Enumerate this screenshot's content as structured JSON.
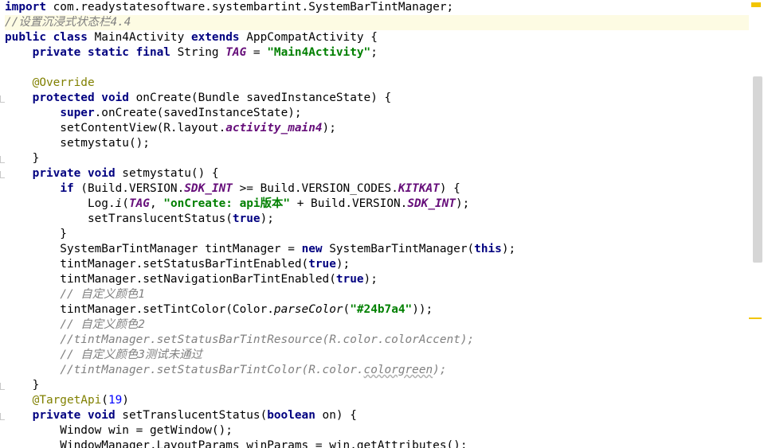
{
  "editor": {
    "lines": [
      [
        {
          "t": "import",
          "c": "kw"
        },
        {
          "t": " com.readystatesoftware.systembartint.SystemBarTintManager;",
          "c": ""
        }
      ],
      [
        {
          "t": "//设置沉浸式状态栏4.4",
          "c": "cmt"
        }
      ],
      [
        {
          "t": "public class",
          "c": "kw"
        },
        {
          "t": " Main4Activity ",
          "c": ""
        },
        {
          "t": "extends",
          "c": "kw"
        },
        {
          "t": " AppCompatActivity {",
          "c": ""
        }
      ],
      [
        {
          "t": "    ",
          "c": ""
        },
        {
          "t": "private static final",
          "c": "kw"
        },
        {
          "t": " String ",
          "c": ""
        },
        {
          "t": "TAG",
          "c": "fld"
        },
        {
          "t": " = ",
          "c": ""
        },
        {
          "t": "\"Main4Activity\"",
          "c": "str"
        },
        {
          "t": ";",
          "c": ""
        }
      ],
      [],
      [
        {
          "t": "    ",
          "c": ""
        },
        {
          "t": "@Override",
          "c": "ann"
        }
      ],
      [
        {
          "t": "    ",
          "c": ""
        },
        {
          "t": "protected void",
          "c": "kw"
        },
        {
          "t": " onCreate(Bundle savedInstanceState) {",
          "c": ""
        }
      ],
      [
        {
          "t": "        ",
          "c": ""
        },
        {
          "t": "super",
          "c": "kw"
        },
        {
          "t": ".onCreate(savedInstanceState);",
          "c": ""
        }
      ],
      [
        {
          "t": "        setContentView(R.layout.",
          "c": ""
        },
        {
          "t": "activity_main4",
          "c": "fld"
        },
        {
          "t": ");",
          "c": ""
        }
      ],
      [
        {
          "t": "        setmystatu();",
          "c": ""
        }
      ],
      [
        {
          "t": "    }",
          "c": ""
        }
      ],
      [
        {
          "t": "    ",
          "c": ""
        },
        {
          "t": "private void",
          "c": "kw"
        },
        {
          "t": " setmystatu() {",
          "c": ""
        }
      ],
      [
        {
          "t": "        ",
          "c": ""
        },
        {
          "t": "if",
          "c": "kw"
        },
        {
          "t": " (Build.VERSION.",
          "c": ""
        },
        {
          "t": "SDK_INT",
          "c": "fld"
        },
        {
          "t": " >= Build.VERSION_CODES.",
          "c": ""
        },
        {
          "t": "KITKAT",
          "c": "fld"
        },
        {
          "t": ") {",
          "c": ""
        }
      ],
      [
        {
          "t": "            Log.",
          "c": ""
        },
        {
          "t": "i",
          "c": "sfn"
        },
        {
          "t": "(",
          "c": ""
        },
        {
          "t": "TAG",
          "c": "fld"
        },
        {
          "t": ", ",
          "c": ""
        },
        {
          "t": "\"onCreate: api版本\"",
          "c": "str"
        },
        {
          "t": " + Build.VERSION.",
          "c": ""
        },
        {
          "t": "SDK_INT",
          "c": "fld"
        },
        {
          "t": ");",
          "c": ""
        }
      ],
      [
        {
          "t": "            setTranslucentStatus(",
          "c": ""
        },
        {
          "t": "true",
          "c": "kw"
        },
        {
          "t": ");",
          "c": ""
        }
      ],
      [
        {
          "t": "        }",
          "c": ""
        }
      ],
      [
        {
          "t": "        SystemBarTintManager tintManager = ",
          "c": ""
        },
        {
          "t": "new",
          "c": "kw"
        },
        {
          "t": " SystemBarTintManager(",
          "c": ""
        },
        {
          "t": "this",
          "c": "kw"
        },
        {
          "t": ");",
          "c": ""
        }
      ],
      [
        {
          "t": "        tintManager.setStatusBarTintEnabled(",
          "c": ""
        },
        {
          "t": "true",
          "c": "kw"
        },
        {
          "t": ");",
          "c": ""
        }
      ],
      [
        {
          "t": "        tintManager.setNavigationBarTintEnabled(",
          "c": ""
        },
        {
          "t": "true",
          "c": "kw"
        },
        {
          "t": ");",
          "c": ""
        }
      ],
      [
        {
          "t": "        ",
          "c": ""
        },
        {
          "t": "// 自定义颜色1",
          "c": "cmt"
        }
      ],
      [
        {
          "t": "        tintManager.setTintColor(Color.",
          "c": ""
        },
        {
          "t": "parseColor",
          "c": "sfn"
        },
        {
          "t": "(",
          "c": ""
        },
        {
          "t": "\"#24b7a4\"",
          "c": "str"
        },
        {
          "t": "));",
          "c": ""
        }
      ],
      [
        {
          "t": "        ",
          "c": ""
        },
        {
          "t": "// 自定义颜色2",
          "c": "cmt"
        }
      ],
      [
        {
          "t": "        ",
          "c": ""
        },
        {
          "t": "//tintManager.setStatusBarTintResource(R.color.colorAccent);",
          "c": "cmt"
        }
      ],
      [
        {
          "t": "        ",
          "c": ""
        },
        {
          "t": "// 自定义颜色3测试未通过",
          "c": "cmt"
        }
      ],
      [
        {
          "t": "        ",
          "c": ""
        },
        {
          "t": "//tintManager.setStatusBarTintColor(R.color.",
          "c": "cmt"
        },
        {
          "t": "colorgreen",
          "c": "cmt squiggle"
        },
        {
          "t": ");",
          "c": "cmt"
        }
      ],
      [
        {
          "t": "    }",
          "c": ""
        }
      ],
      [
        {
          "t": "    ",
          "c": ""
        },
        {
          "t": "@TargetApi",
          "c": "ann"
        },
        {
          "t": "(",
          "c": ""
        },
        {
          "t": "19",
          "c": "num"
        },
        {
          "t": ")",
          "c": ""
        }
      ],
      [
        {
          "t": "    ",
          "c": ""
        },
        {
          "t": "private void",
          "c": "kw"
        },
        {
          "t": " setTranslucentStatus(",
          "c": ""
        },
        {
          "t": "boolean",
          "c": "kw"
        },
        {
          "t": " on) {",
          "c": ""
        }
      ],
      [
        {
          "t": "        Window win = getWindow();",
          "c": ""
        }
      ],
      [
        {
          "t": "        WindowManager.LayoutParams winParams = win.getAttributes();",
          "c": ""
        }
      ]
    ],
    "current_line": 1
  },
  "colors": {
    "keyword": "#000080",
    "string": "#008000",
    "comment": "#808080",
    "annotation": "#808000",
    "field": "#660e7a",
    "number": "#0000ff",
    "current_line_bg": "#fdfbe3",
    "marker": "#f2c500",
    "scrollbar_thumb": "#d6d6d6"
  }
}
